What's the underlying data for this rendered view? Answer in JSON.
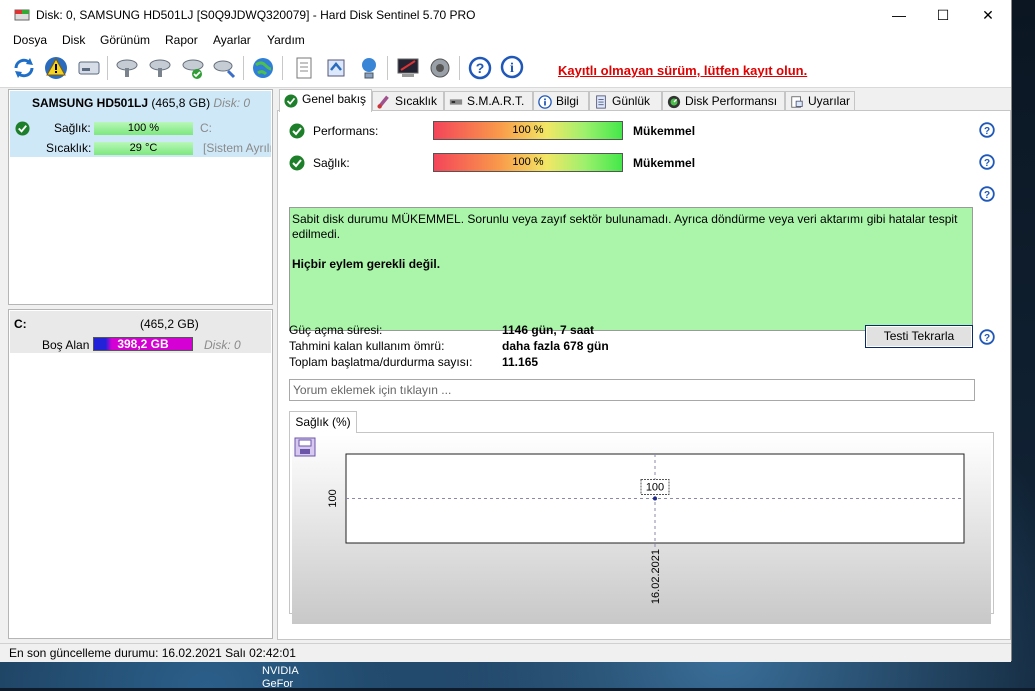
{
  "window": {
    "title": "Disk: 0, SAMSUNG HD501LJ [S0Q9JDWQ320079]  -  Hard Disk Sentinel 5.70 PRO",
    "controls": {
      "minimize": "—",
      "maximize": "☐",
      "close": "✕"
    }
  },
  "menu": [
    "Dosya",
    "Disk",
    "Görünüm",
    "Rapor",
    "Ayarlar",
    "Yardım"
  ],
  "toolbar": {
    "icons": [
      "refresh-icon",
      "warning-icon",
      "disk-icon",
      "disk-tool-1-icon",
      "disk-tool-2-icon",
      "disk-ok-icon",
      "disk-tool-3-icon",
      "globe-icon",
      "report-icon",
      "send-report-icon",
      "network-icon",
      "alert-config-icon",
      "sound-icon",
      "help-icon",
      "info-icon"
    ],
    "register_text": "Kayıtlı olmayan sürüm, lütfen kayıt olun."
  },
  "disk": {
    "name": "SAMSUNG HD501LJ",
    "size": "(465,8 GB)",
    "index": "Disk: 0",
    "health_label": "Sağlık:",
    "health_value": "100 %",
    "health_fraction": 1.0,
    "health_drive": "C:",
    "temp_label": "Sıcaklık:",
    "temp_value": "29 °C",
    "temp_note": "[Sistem Ayrılı"
  },
  "partition": {
    "letter": "C:",
    "size": "(465,2 GB)",
    "free_label": "Boş Alan",
    "free_value": "398,2 GB",
    "disk": "Disk: 0"
  },
  "tabs": [
    "Genel bakış",
    "Sıcaklık",
    "S.M.A.R.T.",
    "Bilgi",
    "Günlük",
    "Disk Performansı",
    "Uyarılar"
  ],
  "overview": {
    "performance_label": "Performans:",
    "performance_value": "100 %",
    "performance_status": "Mükemmel",
    "health_label": "Sağlık:",
    "health_value": "100 %",
    "health_status": "Mükemmel",
    "status_text": "Sabit disk durumu MÜKEMMEL. Sorunlu veya zayıf sektör bulunamadı. Ayrıca döndürme veya veri aktarımı gibi hatalar tespit edilmedi.",
    "action_text": "Hiçbir eylem gerekli değil.",
    "power_on_label": "Güç açma süresi:",
    "power_on_value": "1146 gün, 7 saat",
    "lifetime_label": "Tahmini kalan kullanım ömrü:",
    "lifetime_value": "daha fazla 678 gün",
    "startstop_label": "Toplam başlatma/durdurma sayısı:",
    "startstop_value": "11.165",
    "retest_label": "Testi Tekrarla",
    "comment_placeholder": "Yorum ekle­mek için tıklayın ..."
  },
  "chart_tab_label": "Sağlık (%)",
  "chart_data": {
    "type": "line",
    "x": [
      "16.02.2021"
    ],
    "series": [
      {
        "values": [
          100
        ]
      }
    ],
    "yticks": [
      "100"
    ],
    "xticks": [
      "16.02.2021"
    ],
    "data_labels": [
      "100"
    ],
    "grid": true
  },
  "status_bar": "En son güncelleme durumu: 16.02.2021 Salı 02:42:01",
  "desktop_label": "NVIDIA\nGeFor",
  "colors": {
    "ok_green": "#2e9e35",
    "link_red": "#e00000",
    "status_bg": "#aaf5aa",
    "free_bar": "#d400d4"
  }
}
